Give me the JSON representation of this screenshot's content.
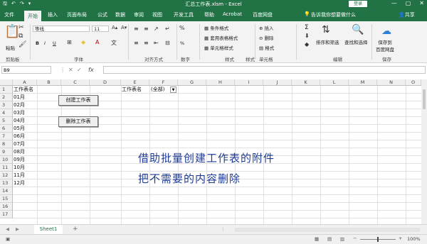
{
  "title": {
    "text": "汇总工作表.xlsm - Excel",
    "login": "登录",
    "quick_access": [
      "save-icon",
      "undo-icon",
      "redo-icon",
      "customize-icon"
    ],
    "window_buttons": [
      "—",
      "▢",
      "✕"
    ]
  },
  "tabs": [
    "文件",
    "开始",
    "插入",
    "页面布局",
    "公式",
    "数据",
    "审阅",
    "视图",
    "开发工具",
    "帮助",
    "Acrobat",
    "百度网盘"
  ],
  "tell_me": "告诉我你想要做什么",
  "share": "共享",
  "ribbon": {
    "font_name": "等线",
    "font_size": "11",
    "number_format": "常规",
    "styles": [
      "条件格式",
      "套用表格格式",
      "单元格样式"
    ],
    "cells": [
      "插入",
      "删除",
      "格式"
    ],
    "sum_label": "Σ",
    "sort_filter": "排序和筛选",
    "find_select": "查找和选择",
    "save_to": "保存到\n百度网盘",
    "groups": [
      "剪贴板",
      "字体",
      "对齐方式",
      "数字",
      "样式",
      "单元格",
      "编辑",
      "保存"
    ],
    "paste": "粘贴",
    "bold": "B",
    "italic": "I",
    "underline": "U",
    "percent": "%"
  },
  "formula_bar": {
    "name_box": "B9",
    "fx": "fx",
    "value": ""
  },
  "columns": [
    "A",
    "B",
    "C",
    "D",
    "E",
    "F",
    "G",
    "H",
    "I",
    "J",
    "K",
    "L",
    "M",
    "N",
    "O"
  ],
  "rows": [
    "1",
    "2",
    "3",
    "4",
    "5",
    "6",
    "7",
    "8",
    "9",
    "10",
    "11",
    "12",
    "13",
    "14",
    "15",
    "16",
    "17"
  ],
  "cells": {
    "a1": "工作表名",
    "months": [
      "01月",
      "02月",
      "03月",
      "04月",
      "05月",
      "06月",
      "07月",
      "08月",
      "09月",
      "10月",
      "11月",
      "12月"
    ],
    "e1": "工作表名",
    "f1": "(全部)"
  },
  "buttons": {
    "create": "创建工作表",
    "delete": "删除工作表"
  },
  "note_lines": [
    "借助批量创建工作表的附件",
    "把不需要的内容删除"
  ],
  "sheet_tab": "Sheet1",
  "add_sheet": "+",
  "zoom": "100%"
}
